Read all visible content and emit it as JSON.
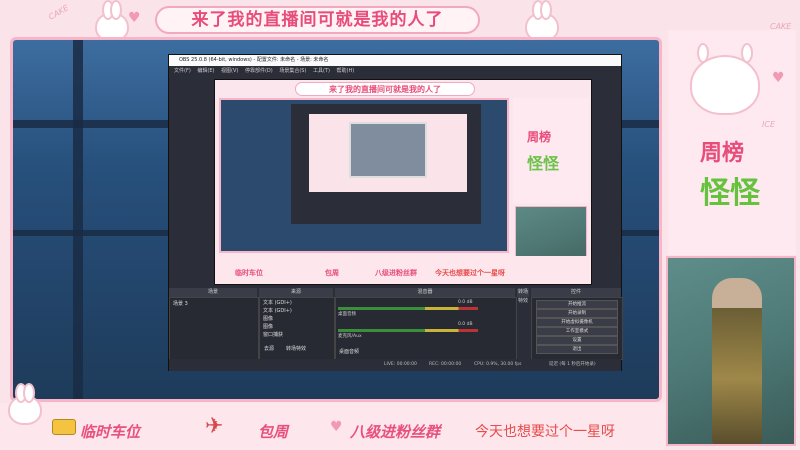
{
  "overlay": {
    "title_banner": "来了我的直播间可就是我的人了",
    "side_panel": {
      "week_label": "周榜",
      "name": "怪怪",
      "cake_text": "CAKE",
      "ice_text": "ICE"
    },
    "bottom_items": [
      "临时车位",
      "包周",
      "八级进粉丝群",
      "今天也想要过个一星呀"
    ]
  },
  "obs": {
    "window_title": "OBS 25.0.8 (64-bit, windows) - 配置文件: 未命名 - 场景: 未命名",
    "menu": [
      "文件(F)",
      "编辑(E)",
      "视图(V)",
      "停靠部件(D)",
      "场景集合(S)",
      "工具(T)",
      "帮助(H)"
    ],
    "preview": {
      "banner": "来了我的直播间可就是我的人了",
      "week_label": "周榜",
      "name": "怪怪",
      "bottom_items": [
        "临时车位",
        "包周",
        "八级进粉丝群",
        "今天也想要过个一星呀"
      ]
    },
    "docks": {
      "scenes": {
        "title": "场景",
        "items": [
          "场景 3"
        ]
      },
      "sources": {
        "title": "来源",
        "items": [
          "文本 (GDI+)",
          "文本 (GDI+)",
          "图像",
          "图像",
          "窗口捕获"
        ],
        "buttons": [
          "去源",
          "转场特效"
        ]
      },
      "mixer": {
        "title": "混音器",
        "channels": [
          {
            "name": "桌面音频",
            "level": "0.0 dB"
          },
          {
            "name": "麦克风/Aux",
            "level": "0.0 dB"
          }
        ],
        "footer": "桌面音频"
      },
      "transitions": {
        "title": "转场特效"
      },
      "controls": {
        "title": "控件",
        "buttons": [
          "开始推流",
          "开始录制",
          "开始虚拟摄像机",
          "工作室模式",
          "设置",
          "退出"
        ]
      }
    },
    "status": {
      "live": "LIVE: 00:00:00",
      "rec": "REC: 00:00:00",
      "cpu": "CPU: 0.9%, 30.00 fps",
      "extra": "延迟 (每 1 秒后开始录)"
    }
  }
}
